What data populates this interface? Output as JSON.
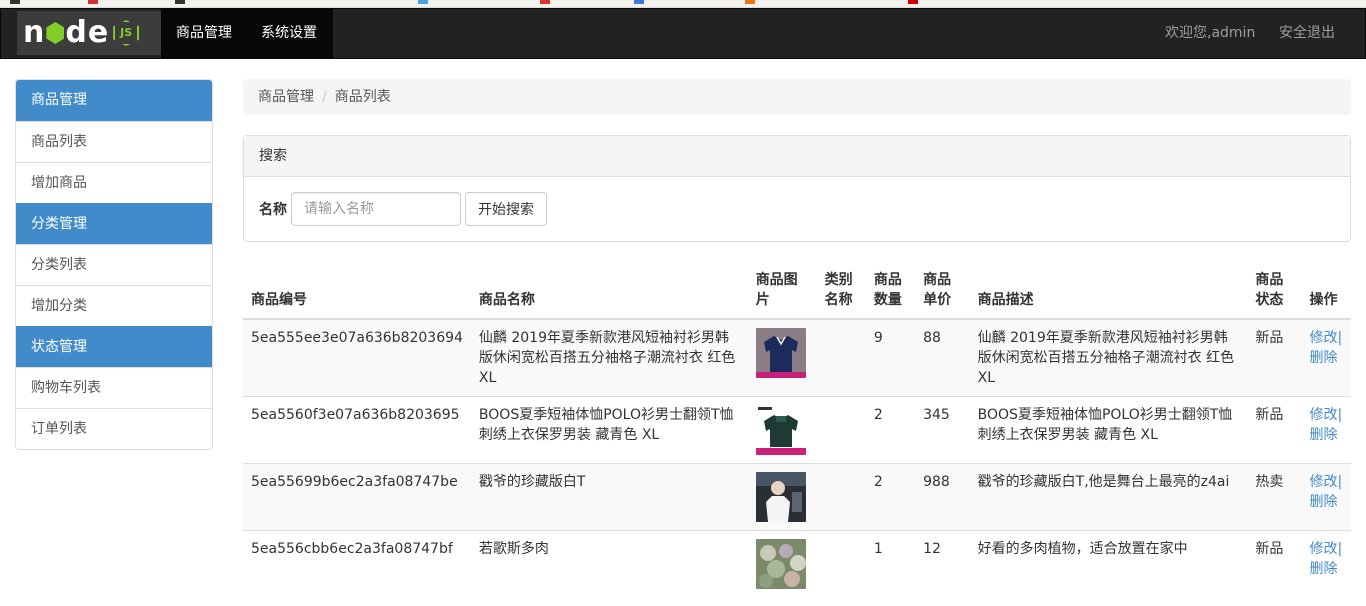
{
  "navbar": {
    "brand_text": "node",
    "brand_badge": "JS",
    "menu": [
      "商品管理",
      "系统设置"
    ],
    "welcome": "欢迎您,admin",
    "logout": "安全退出"
  },
  "sidebar": {
    "items": [
      {
        "label": "商品管理",
        "active": true
      },
      {
        "label": "商品列表",
        "active": false
      },
      {
        "label": "增加商品",
        "active": false
      },
      {
        "label": "分类管理",
        "active": true
      },
      {
        "label": "分类列表",
        "active": false
      },
      {
        "label": "增加分类",
        "active": false
      },
      {
        "label": "状态管理",
        "active": true
      },
      {
        "label": "购物车列表",
        "active": false
      },
      {
        "label": "订单列表",
        "active": false
      }
    ]
  },
  "breadcrumb": [
    "商品管理",
    "商品列表"
  ],
  "search": {
    "heading": "搜索",
    "label": "名称",
    "placeholder": "请输入名称",
    "button": "开始搜索"
  },
  "table": {
    "headers": [
      "商品编号",
      "商品名称",
      "商品图片",
      "类别名称",
      "商品数量",
      "商品单价",
      "商品描述",
      "商品状态",
      "操作"
    ],
    "rows": [
      {
        "id": "5ea555ee3e07a636b8203694",
        "name": "仙麟 2019年夏季新款港风短袖衬衫男韩版休闲宽松百搭五分袖格子潮流衬衣 红色 XL",
        "image": "navy-polo-shirt",
        "category": "",
        "quantity": "9",
        "price": "88",
        "description": "仙麟 2019年夏季新款港风短袖衬衫男韩版休闲宽松百搭五分袖格子潮流衬衣 红色 XL",
        "status": "新品",
        "edit": "修改|",
        "delete": "删除"
      },
      {
        "id": "5ea5560f3e07a636b8203695",
        "name": "BOOS夏季短袖体恤POLO衫男士翻领T恤刺绣上衣保罗男装 藏青色 XL",
        "image": "dark-green-polo",
        "category": "",
        "quantity": "2",
        "price": "345",
        "description": "BOOS夏季短袖体恤POLO衫男士翻领T恤刺绣上衣保罗男装 藏青色 XL",
        "status": "新品",
        "edit": "修改|",
        "delete": "删除"
      },
      {
        "id": "5ea55699b6ec2a3fa08747be",
        "name": "戳爷的珍藏版白T",
        "image": "white-tshirt-stage",
        "category": "",
        "quantity": "2",
        "price": "988",
        "description": "戳爷的珍藏版白T,他是舞台上最亮的z4ai",
        "status": "热卖",
        "edit": "修改|",
        "delete": "删除"
      },
      {
        "id": "5ea556cbb6ec2a3fa08747bf",
        "name": "若歌斯多肉",
        "image": "succulent-plants",
        "category": "",
        "quantity": "1",
        "price": "12",
        "description": "好看的多肉植物，适合放置在家中",
        "status": "新品",
        "edit": "修改|",
        "delete": "删除"
      }
    ]
  },
  "colors": {
    "navbar_bg": "#222222",
    "active_blue": "#428bca",
    "link_blue": "#428bca",
    "node_green": "#83cd29"
  }
}
